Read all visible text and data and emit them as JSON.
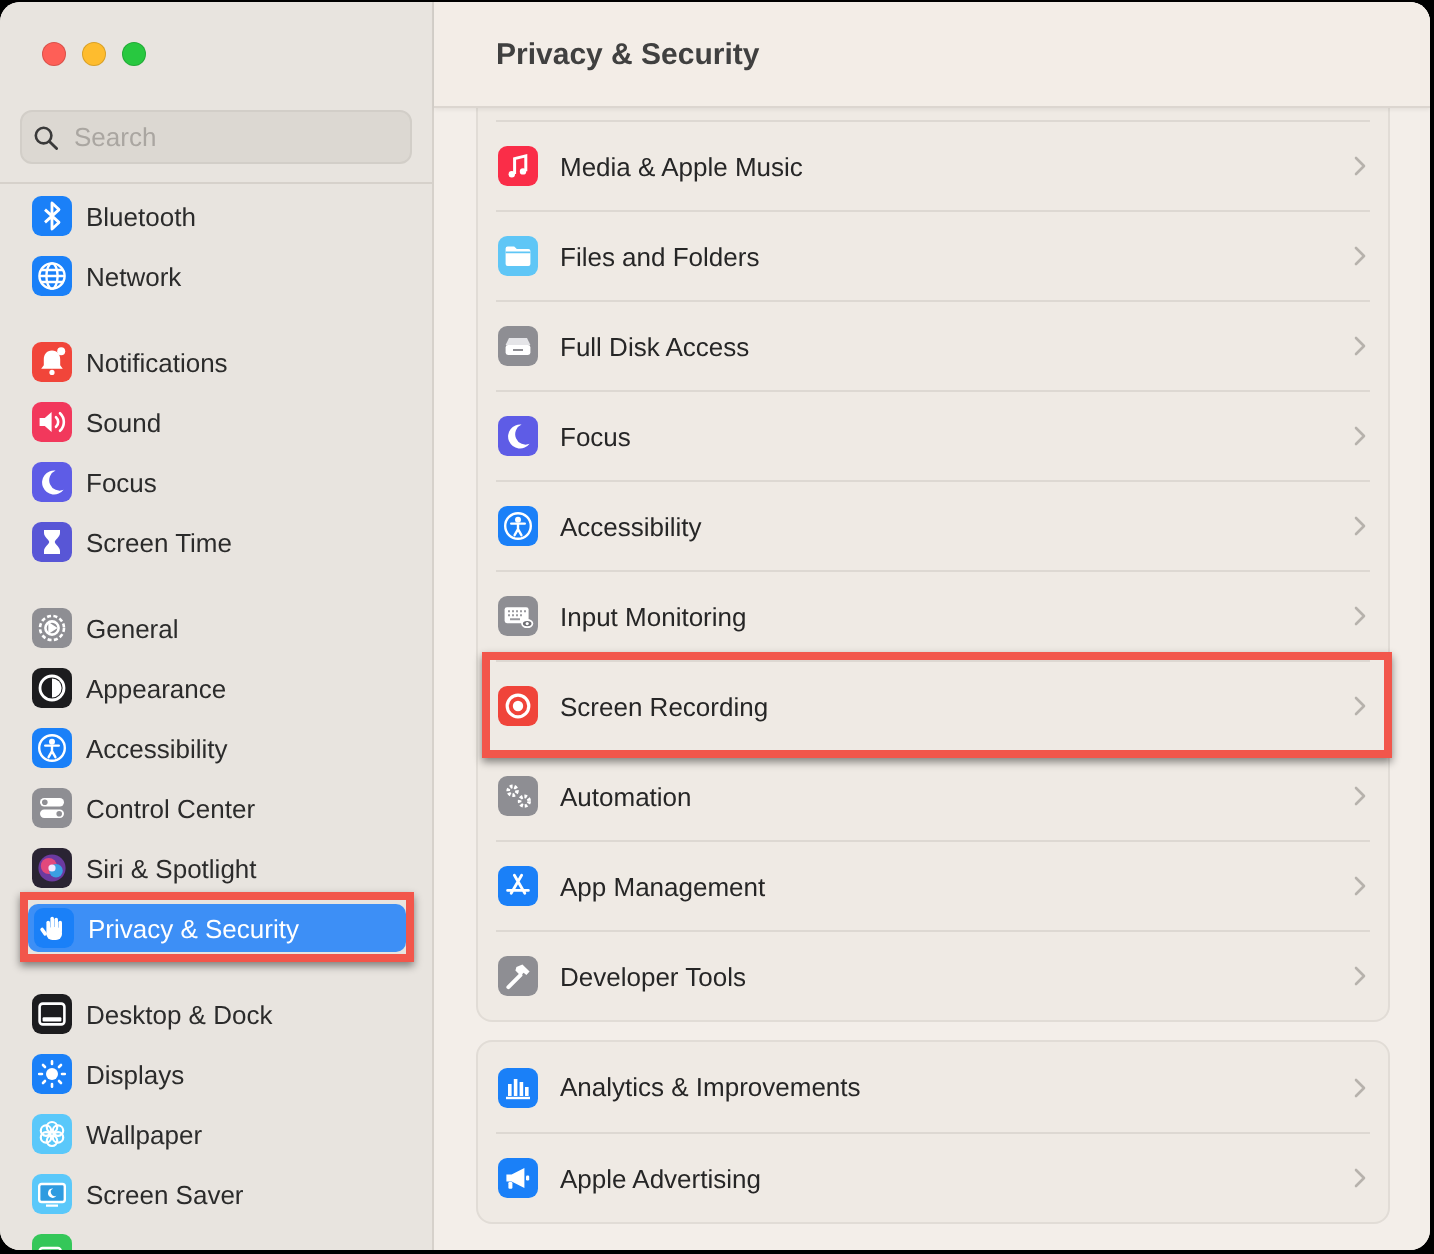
{
  "toolbar": {
    "title": "Privacy & Security"
  },
  "sidebar": {
    "search": {
      "placeholder": "Search"
    },
    "groups": [
      {
        "items": [
          {
            "label": "Bluetooth",
            "selected": false,
            "highlighted": false
          },
          {
            "label": "Network",
            "selected": false,
            "highlighted": false
          }
        ]
      },
      {
        "items": [
          {
            "label": "Notifications",
            "selected": false,
            "highlighted": false
          },
          {
            "label": "Sound",
            "selected": false,
            "highlighted": false
          },
          {
            "label": "Focus",
            "selected": false,
            "highlighted": false
          },
          {
            "label": "Screen Time",
            "selected": false,
            "highlighted": false
          }
        ]
      },
      {
        "items": [
          {
            "label": "General",
            "selected": false,
            "highlighted": false
          },
          {
            "label": "Appearance",
            "selected": false,
            "highlighted": false
          },
          {
            "label": "Accessibility",
            "selected": false,
            "highlighted": false
          },
          {
            "label": "Control Center",
            "selected": false,
            "highlighted": false
          },
          {
            "label": "Siri & Spotlight",
            "selected": false,
            "highlighted": false
          },
          {
            "label": "Privacy & Security",
            "selected": true,
            "highlighted": true
          }
        ]
      },
      {
        "items": [
          {
            "label": "Desktop & Dock",
            "selected": false,
            "highlighted": false
          },
          {
            "label": "Displays",
            "selected": false,
            "highlighted": false
          },
          {
            "label": "Wallpaper",
            "selected": false,
            "highlighted": false
          },
          {
            "label": "Screen Saver",
            "selected": false,
            "highlighted": false
          },
          {
            "selected": false,
            "highlighted": false
          }
        ]
      }
    ]
  },
  "content": {
    "sections": [
      {
        "rows": [
          {
            "label": "Media & Apple Music",
            "highlighted": false
          },
          {
            "label": "Files and Folders",
            "highlighted": false
          },
          {
            "label": "Full Disk Access",
            "highlighted": false
          },
          {
            "label": "Focus",
            "highlighted": false
          },
          {
            "label": "Accessibility",
            "highlighted": false
          },
          {
            "label": "Input Monitoring",
            "highlighted": false
          },
          {
            "label": "Screen Recording",
            "highlighted": true
          },
          {
            "label": "Automation",
            "highlighted": false
          },
          {
            "label": "App Management",
            "highlighted": false
          },
          {
            "label": "Developer Tools",
            "highlighted": false
          }
        ]
      },
      {
        "rows": [
          {
            "label": "Analytics & Improvements",
            "highlighted": false
          },
          {
            "label": "Apple Advertising",
            "highlighted": false
          }
        ]
      }
    ]
  }
}
